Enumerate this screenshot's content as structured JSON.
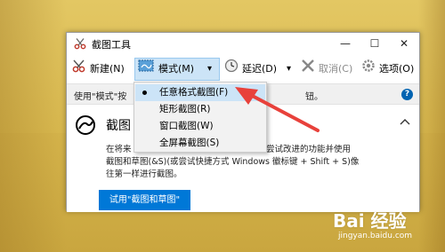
{
  "window": {
    "title": "截图工具",
    "minimize": "—",
    "maximize": "☐",
    "close": "✕"
  },
  "toolbar": {
    "new_label": "新建(N)",
    "mode_label": "模式(M)",
    "delay_label": "延迟(D)",
    "cancel_label": "取消(C)",
    "options_label": "选项(O)",
    "dropdown_arrow": "▾"
  },
  "infobar": {
    "text": "使用\"模式\"按",
    "text_end": "钮。",
    "help": "?"
  },
  "panel": {
    "title": "截图",
    "line1a": "在将来",
    "line1b": "尝试改进的功能并使用",
    "line2": "截图和草图(&S)(或尝试快捷方式 Windows 徽标键 + Shift + S)像",
    "line3": "往第一样进行截图。",
    "button": "试用\"截图和草图\""
  },
  "menu": {
    "items": [
      {
        "label": "任意格式截图(F)",
        "selected": true
      },
      {
        "label": "矩形截图(R)",
        "selected": false
      },
      {
        "label": "窗口截图(W)",
        "selected": false
      },
      {
        "label": "全屏幕截图(S)",
        "selected": false
      }
    ]
  },
  "watermark": {
    "logo": "Bai 经验",
    "url": "jingyan.baidu.com"
  },
  "colors": {
    "accent": "#0078d7",
    "highlight": "#cce4f7",
    "annotation": "#e8413b"
  }
}
